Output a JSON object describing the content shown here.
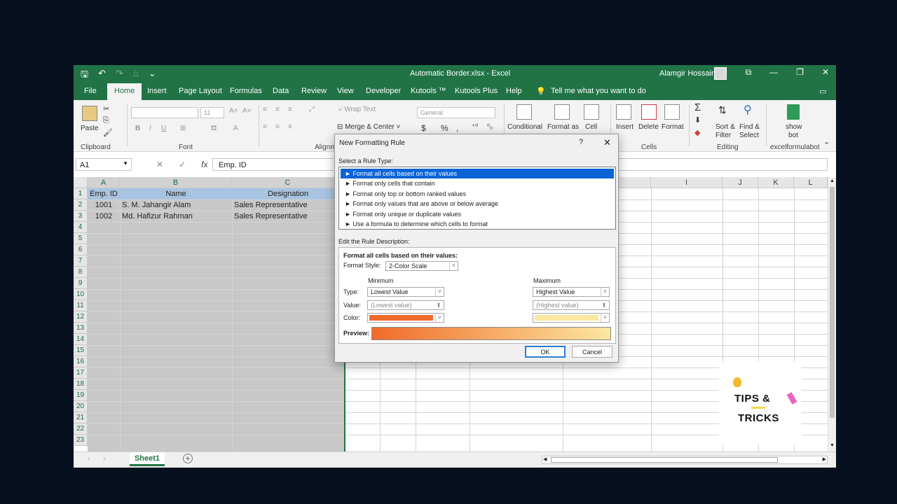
{
  "window": {
    "title": "Automatic Border.xlsx  -  Excel",
    "user": "Alamgir Hossain",
    "controls": [
      "⧉",
      "—",
      "❐",
      "✕"
    ]
  },
  "quick_access": [
    "🖫",
    "↶",
    "↷",
    "⌂",
    "⌄"
  ],
  "menu": {
    "tabs": [
      "File",
      "Home",
      "Insert",
      "Page Layout",
      "Formulas",
      "Data",
      "Review",
      "View",
      "Developer",
      "Kutools ™",
      "Kutools Plus",
      "Help"
    ],
    "active": "Home",
    "tell_me": "Tell me what you want to do"
  },
  "ribbon": {
    "clipboard": {
      "paste": "Paste",
      "group": "Clipboard"
    },
    "font": {
      "name": "",
      "size": "11",
      "group": "Font"
    },
    "alignment": {
      "wrap": "Wrap Text",
      "merge": "Merge & Center",
      "group": "Alignm"
    },
    "number": {
      "format": "General",
      "currency": "$",
      "percent": "%"
    },
    "styles": {
      "conditional": "Conditional",
      "format_as": "Format as",
      "cell": "Cell"
    },
    "cells": {
      "insert": "Insert",
      "delete": "Delete",
      "format": "Format",
      "group": "Cells"
    },
    "editing": {
      "sort": "Sort &",
      "filter": "Filter",
      "find": "Find &",
      "select": "Select",
      "group": "Editing"
    },
    "bot": {
      "show": "show",
      "bot": "bot",
      "group": "excelformulabot"
    }
  },
  "formula_bar": {
    "name_box": "A1",
    "fx": "fx",
    "value": "Emp. ID"
  },
  "grid": {
    "columns": [
      "A",
      "B",
      "C",
      "I",
      "J",
      "K",
      "L"
    ],
    "rows": [
      "1",
      "2",
      "3",
      "4",
      "5",
      "6",
      "7",
      "8",
      "9",
      "10",
      "11",
      "12",
      "13",
      "14",
      "15",
      "16",
      "17",
      "18",
      "19",
      "20",
      "21",
      "22",
      "23"
    ],
    "headers": [
      "Emp. ID",
      "Name",
      "Designation"
    ],
    "data": [
      [
        "1001",
        "S. M. Jahangir Alam",
        "Sales Representative"
      ],
      [
        "1002",
        "Md. Hafizur Rahman",
        "Sales Representative"
      ]
    ]
  },
  "sheets": {
    "active": "Sheet1",
    "add": "+"
  },
  "dialog": {
    "title": "New Formatting Rule",
    "help": "?",
    "close": "✕",
    "select_label": "Select a Rule Type:",
    "rule_types": [
      "Format all cells based on their values",
      "Format only cells that contain",
      "Format only top or bottom ranked values",
      "Format only values that are above or below average",
      "Format only unique or duplicate values",
      "Use a formula to determine which cells to format"
    ],
    "selected_rule": 0,
    "edit_label": "Edit the Rule Description:",
    "desc_title": "Format all cells based on their values:",
    "format_style_label": "Format Style:",
    "format_style": "2-Color Scale",
    "minimum_label": "Minimum",
    "maximum_label": "Maximum",
    "type_label": "Type:",
    "value_label": "Value:",
    "color_label": "Color:",
    "min_type": "Lowest Value",
    "max_type": "Highest Value",
    "min_value": "(Lowest value)",
    "max_value": "(Highest value)",
    "min_color": "#f06b2a",
    "max_color": "#fbe7a0",
    "preview_label": "Preview:",
    "ok": "OK",
    "cancel": "Cancel"
  },
  "watermark": {
    "line1": "TIPS &",
    "line2": "TRICKS"
  }
}
